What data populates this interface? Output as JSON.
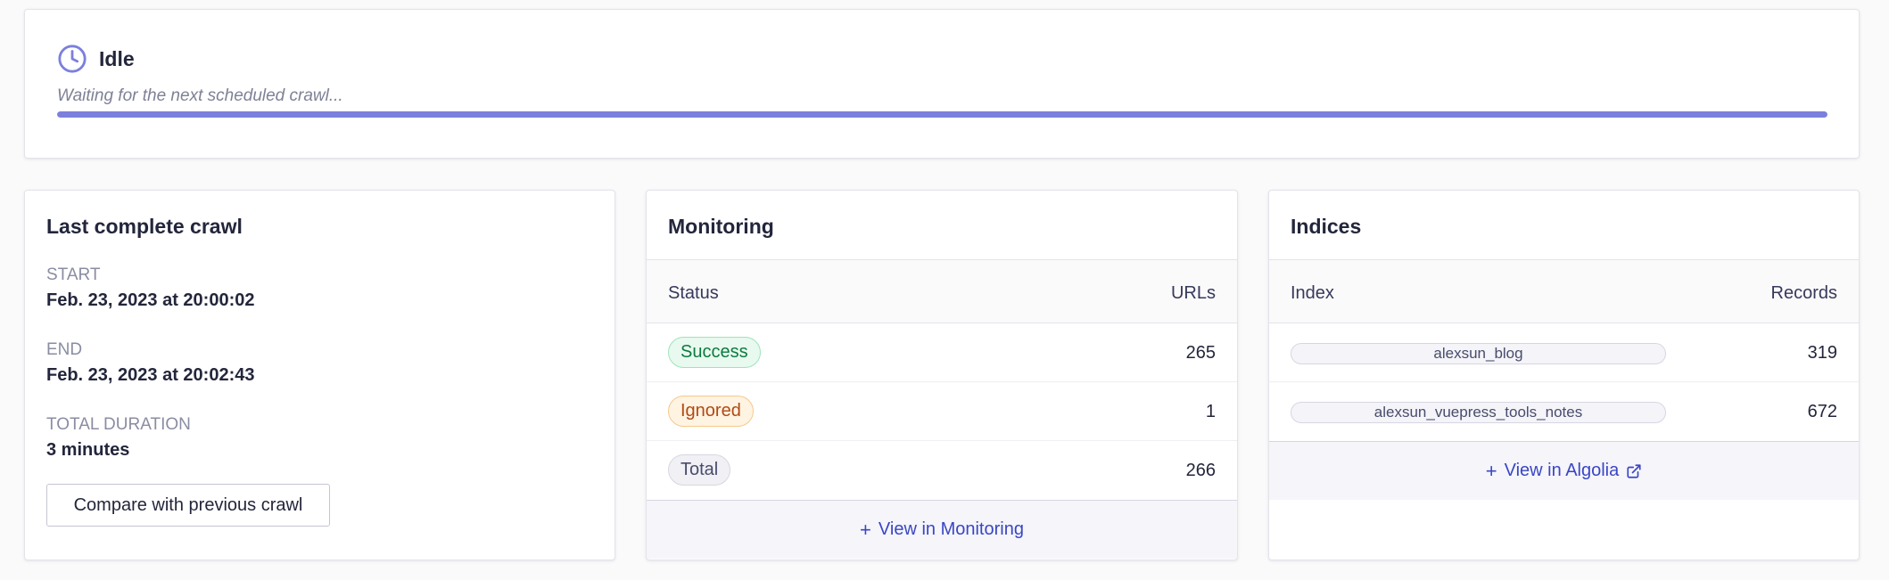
{
  "status": {
    "icon": "clock-icon",
    "title": "Idle",
    "subtitle": "Waiting for the next scheduled crawl...",
    "progress_percent": 100,
    "accent": "#7b80dc"
  },
  "last_crawl": {
    "title": "Last complete crawl",
    "start_label": "START",
    "start_value": "Feb. 23, 2023 at 20:00:02",
    "end_label": "END",
    "end_value": "Feb. 23, 2023 at 20:02:43",
    "duration_label": "TOTAL DURATION",
    "duration_value": "3 minutes",
    "compare_button": "Compare with previous crawl"
  },
  "monitoring": {
    "title": "Monitoring",
    "columns": [
      "Status",
      "URLs"
    ],
    "rows": [
      {
        "status": "Success",
        "urls": "265",
        "color": "#0c7a3e"
      },
      {
        "status": "Ignored",
        "urls": "1",
        "color": "#b04a14"
      },
      {
        "status": "Total",
        "urls": "266",
        "color": "#484c6b"
      }
    ],
    "link": "View in Monitoring",
    "link_icon": "plus-icon"
  },
  "indices": {
    "title": "Indices",
    "columns": [
      "Index",
      "Records"
    ],
    "rows": [
      {
        "index": "alexsun_blog",
        "records": "319"
      },
      {
        "index": "alexsun_vuepress_tools_notes",
        "records": "672"
      }
    ],
    "link": "View in Algolia",
    "link_icon": "plus-icon",
    "external_icon": "external-link-icon"
  }
}
